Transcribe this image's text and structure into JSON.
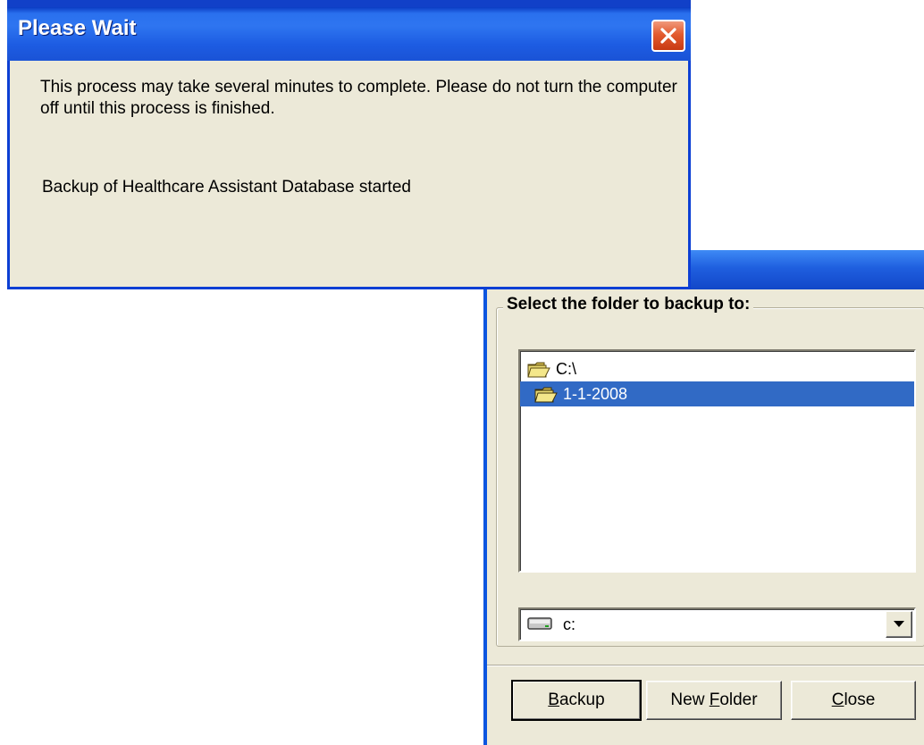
{
  "wait_dialog": {
    "title": "Please Wait",
    "message": "This process may take several minutes to complete. Please do not turn the computer off until this process is finished.",
    "status": "Backup of Healthcare Assistant Database started",
    "close_icon": "close-icon"
  },
  "backup_dialog": {
    "group_label": "Select the folder to backup to:",
    "folders": [
      {
        "label": "C:\\",
        "icon": "open-folder-icon",
        "selected": false
      },
      {
        "label": "1-1-2008",
        "icon": "open-folder-icon",
        "selected": true
      }
    ],
    "drive": {
      "value": "c:",
      "icon": "hard-drive-icon"
    },
    "buttons": {
      "backup_pre": "",
      "backup_key": "B",
      "backup_post": "ackup",
      "newfolder_pre": "New ",
      "newfolder_key": "F",
      "newfolder_post": "older",
      "close_pre": "",
      "close_key": "C",
      "close_post": "lose"
    }
  },
  "colors": {
    "titlebar": "#2e75f0",
    "dialog_bg": "#ece9d8",
    "selection": "#316ac5",
    "close_red": "#e35b2f"
  }
}
